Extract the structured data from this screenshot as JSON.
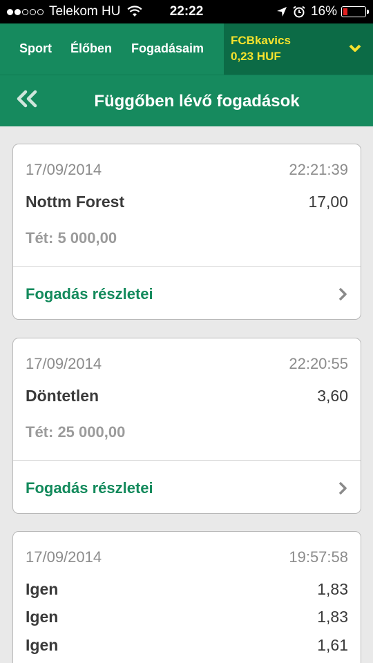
{
  "status_bar": {
    "carrier": "Telekom HU",
    "time": "22:22",
    "battery": "16%",
    "signal_bars": 2
  },
  "nav": {
    "items": [
      {
        "label": "Sport"
      },
      {
        "label": "Élőben"
      },
      {
        "label": "Fogadásaim"
      }
    ],
    "account": {
      "name": "FCBkavics",
      "balance": "0,23 HUF"
    }
  },
  "page": {
    "title": "Függőben lévő fogadások"
  },
  "bets": [
    {
      "date": "17/09/2014",
      "time": "22:21:39",
      "selections": [
        {
          "name": "Nottm Forest",
          "odds": "17,00"
        }
      ],
      "stake": "Tét: 5 000,00",
      "details_label": "Fogadás részletei"
    },
    {
      "date": "17/09/2014",
      "time": "22:20:55",
      "selections": [
        {
          "name": "Döntetlen",
          "odds": "3,60"
        }
      ],
      "stake": "Tét: 25 000,00",
      "details_label": "Fogadás részletei"
    },
    {
      "date": "17/09/2014",
      "time": "19:57:58",
      "selections": [
        {
          "name": "Igen",
          "odds": "1,83"
        },
        {
          "name": "Igen",
          "odds": "1,83"
        },
        {
          "name": "Igen",
          "odds": "1,61"
        }
      ]
    }
  ],
  "colors": {
    "brand_green": "#168a5e",
    "account_yellow": "#f6e22d",
    "link_green": "#138a5c"
  }
}
